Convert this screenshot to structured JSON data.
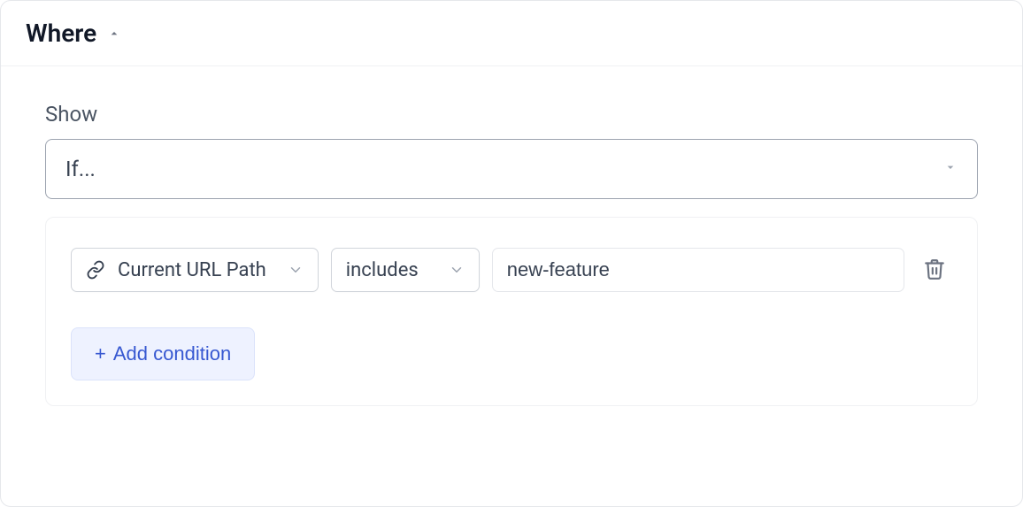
{
  "panel": {
    "title": "Where"
  },
  "show": {
    "label": "Show",
    "selected": "If..."
  },
  "condition": {
    "attribute": "Current URL Path",
    "operator": "includes",
    "value": "new-feature"
  },
  "addButton": {
    "label": "Add condition"
  },
  "icons": {
    "link": "link-icon",
    "chevronDown": "chevron-down-icon",
    "caretUp": "caret-up-icon",
    "caretDown": "caret-down-icon",
    "trash": "trash-icon"
  }
}
